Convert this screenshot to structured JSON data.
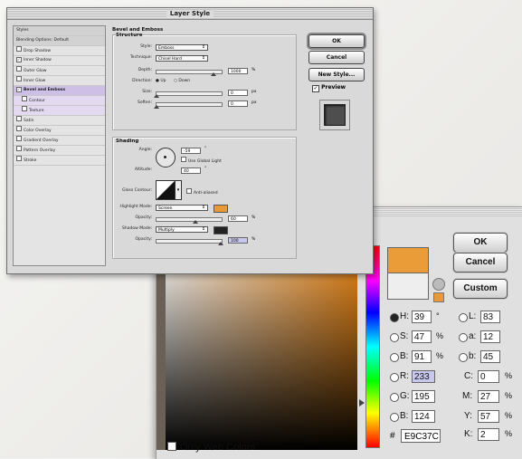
{
  "layer_style": {
    "title": "Layer Style",
    "styles_list": [
      {
        "label": "Styles",
        "type": "head"
      },
      {
        "label": "Blending Options: Default",
        "type": "head"
      },
      {
        "label": "Drop Shadow",
        "checked": false
      },
      {
        "label": "Inner Shadow",
        "checked": true
      },
      {
        "label": "Outer Glow",
        "checked": false
      },
      {
        "label": "Inner Glow",
        "checked": false
      },
      {
        "label": "Bevel and Emboss",
        "checked": true,
        "selected": true
      },
      {
        "label": "Contour",
        "checked": false,
        "sub": true
      },
      {
        "label": "Texture",
        "checked": false,
        "sub": true
      },
      {
        "label": "Satin",
        "checked": false
      },
      {
        "label": "Color Overlay",
        "checked": false
      },
      {
        "label": "Gradient Overlay",
        "checked": false
      },
      {
        "label": "Pattern Overlay",
        "checked": false
      },
      {
        "label": "Stroke",
        "checked": false
      }
    ],
    "section_title": "Bevel and Emboss",
    "structure": {
      "title": "Structure",
      "style_label": "Style:",
      "style_value": "Emboss",
      "technique_label": "Technique:",
      "technique_value": "Chisel Hard",
      "depth_label": "Depth:",
      "depth_value": "1000",
      "depth_unit": "%",
      "direction_label": "Direction:",
      "direction_up": "Up",
      "direction_down": "Down",
      "size_label": "Size:",
      "size_value": "0",
      "size_unit": "px",
      "soften_label": "Soften:",
      "soften_value": "0",
      "soften_unit": "px"
    },
    "shading": {
      "title": "Shading",
      "angle_label": "Angle:",
      "angle_value": "-59",
      "angle_unit": "°",
      "global_light_label": "Use Global Light",
      "altitude_label": "Altitude:",
      "altitude_value": "40",
      "altitude_unit": "°",
      "gloss_label": "Gloss Contour:",
      "antialiased_label": "Anti-aliased",
      "highlight_label": "Highlight Mode:",
      "highlight_value": "Screen",
      "highlight_color": "#e89a3a",
      "hl_opacity_label": "Opacity:",
      "hl_opacity_value": "60",
      "hl_opacity_unit": "%",
      "shadow_label": "Shadow Mode:",
      "shadow_value": "Multiply",
      "shadow_color": "#222222",
      "sh_opacity_label": "Opacity:",
      "sh_opacity_value": "100",
      "sh_opacity_unit": "%"
    },
    "buttons": {
      "ok": "OK",
      "cancel": "Cancel",
      "new_style": "New Style...",
      "preview": "Preview"
    }
  },
  "color_picker": {
    "buttons": {
      "ok": "OK",
      "cancel": "Cancel",
      "custom": "Custom"
    },
    "hsb": [
      {
        "label": "H:",
        "value": "39",
        "unit": "°",
        "selected": true
      },
      {
        "label": "S:",
        "value": "47",
        "unit": "%"
      },
      {
        "label": "B:",
        "value": "91",
        "unit": "%"
      }
    ],
    "rgb": [
      {
        "label": "R:",
        "value": "233"
      },
      {
        "label": "G:",
        "value": "195"
      },
      {
        "label": "B:",
        "value": "124"
      }
    ],
    "lab": [
      {
        "label": "L:",
        "value": "83"
      },
      {
        "label": "a:",
        "value": "12"
      },
      {
        "label": "b:",
        "value": "45"
      }
    ],
    "cmyk": [
      {
        "label": "C:",
        "value": "0",
        "unit": "%"
      },
      {
        "label": "M:",
        "value": "27",
        "unit": "%"
      },
      {
        "label": "Y:",
        "value": "57",
        "unit": "%"
      },
      {
        "label": "K:",
        "value": "2",
        "unit": "%"
      }
    ],
    "hex_label": "#",
    "hex_value": "E9C37C",
    "only_web_colors": "Only Web Colors",
    "new_color": "#ea9c38",
    "old_color": "#eeeeee"
  }
}
